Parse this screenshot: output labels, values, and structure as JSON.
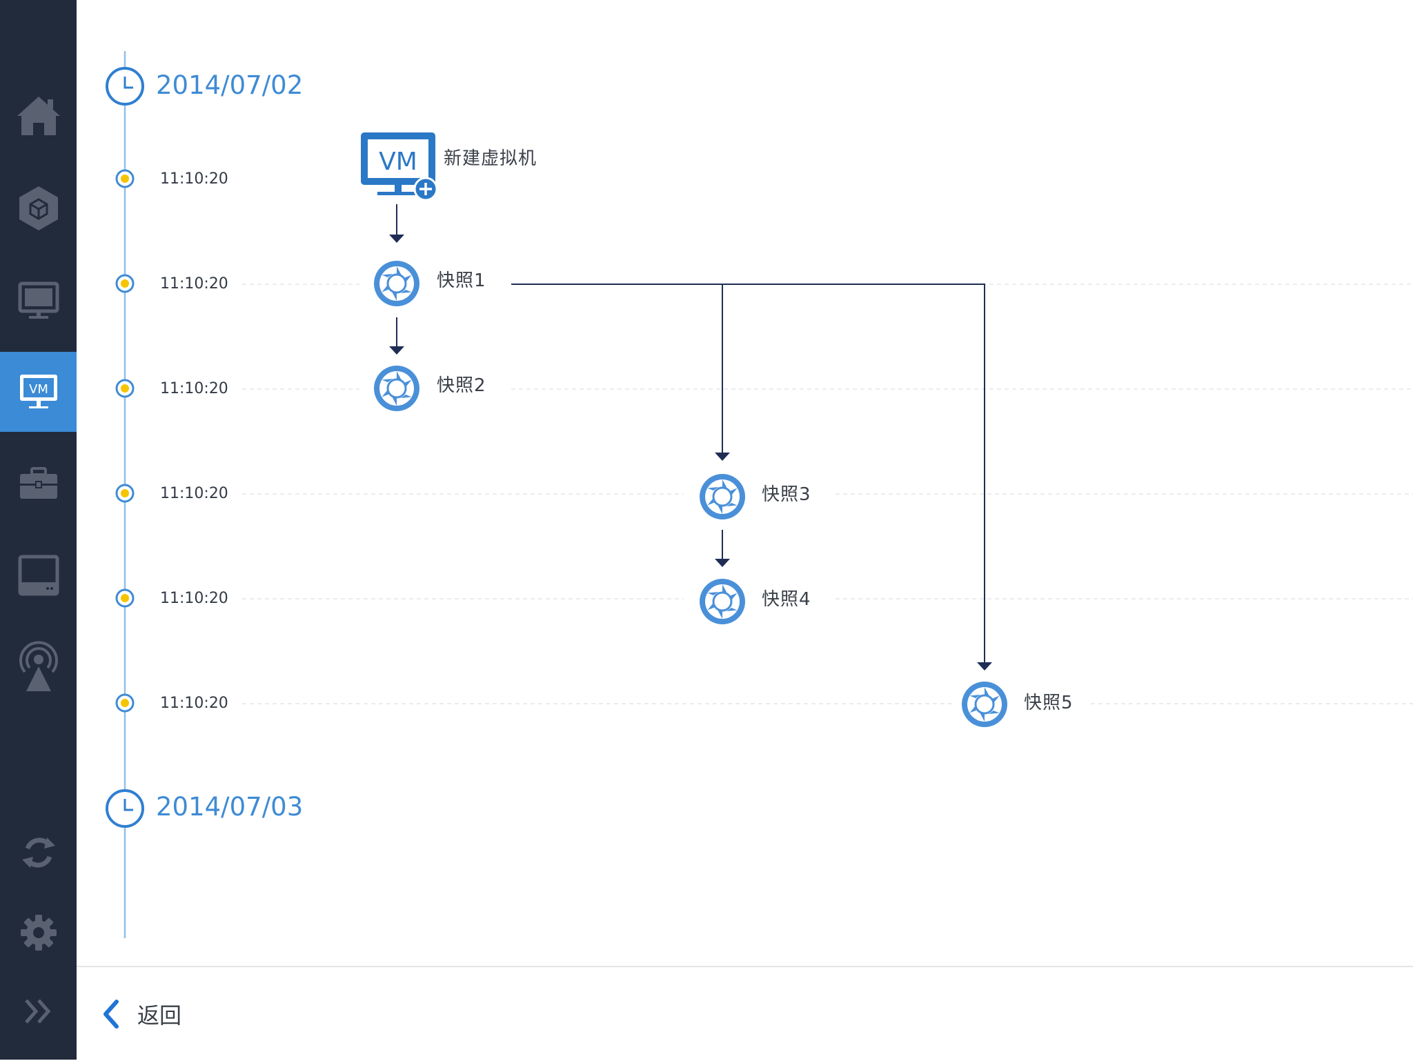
{
  "sidebar": {
    "items": [
      {
        "icon": "home-icon"
      },
      {
        "icon": "cube-icon"
      },
      {
        "icon": "monitor-icon"
      },
      {
        "icon": "vm-icon",
        "active": true,
        "label": "VM"
      },
      {
        "icon": "briefcase-icon"
      },
      {
        "icon": "storage-icon"
      },
      {
        "icon": "broadcast-icon"
      },
      {
        "icon": "refresh-icon"
      },
      {
        "icon": "gear-icon"
      },
      {
        "icon": "double-chevron-right-icon"
      }
    ],
    "active_color": "#3b8bd6",
    "background": "#222b3c"
  },
  "timeline": {
    "dates": [
      "2014/07/02",
      "2014/07/03"
    ],
    "times": [
      "11:10:20",
      "11:10:20",
      "11:10:20",
      "11:10:20",
      "11:10:20",
      "11:10:20"
    ]
  },
  "nodes": {
    "vm": {
      "label": "新建虚拟机",
      "icon_text": "VM",
      "icon": "vm-add-icon"
    },
    "snapshots": [
      {
        "label": "快照1",
        "icon": "aperture-icon"
      },
      {
        "label": "快照2",
        "icon": "aperture-icon"
      },
      {
        "label": "快照3",
        "icon": "aperture-icon"
      },
      {
        "label": "快照4",
        "icon": "aperture-icon"
      },
      {
        "label": "快照5",
        "icon": "aperture-icon"
      }
    ]
  },
  "footer": {
    "back_label": "返回",
    "icon": "chevron-left-icon"
  },
  "colors": {
    "accent": "#3f8bd4",
    "timeline_dot_fill": "#f5c400",
    "connector": "#1f2d55",
    "snapshot_icon": "#4a90d9"
  }
}
